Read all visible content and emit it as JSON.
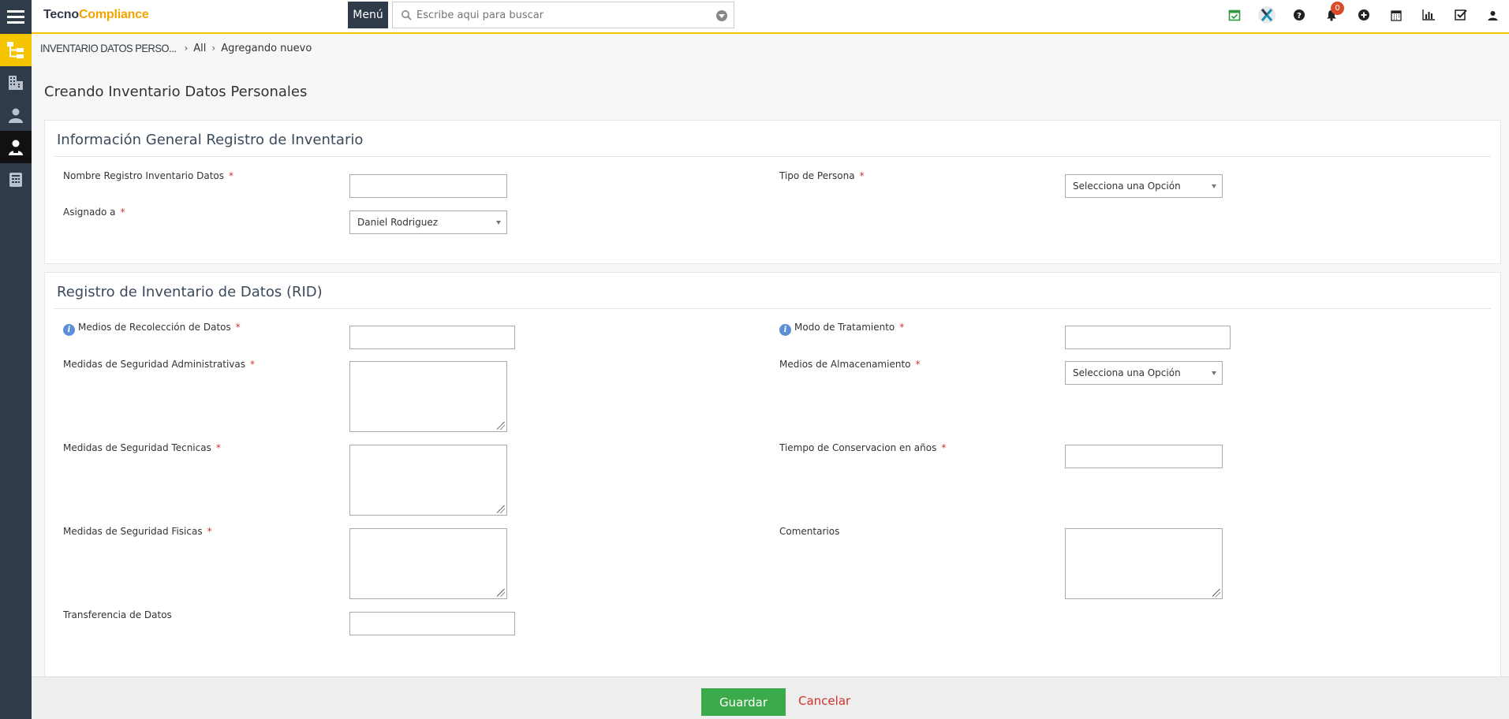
{
  "app": {
    "logo_part1": "Tecno",
    "logo_part2": "Compliance"
  },
  "topbar": {
    "menu_label": "Menú",
    "search_placeholder": "Escribe aqui para buscar",
    "notification_count": "0",
    "icons": [
      "calendar-check-icon",
      "x-logo-icon",
      "help-icon",
      "bell-icon",
      "plus-circle-icon",
      "calendar-icon",
      "bar-chart-icon",
      "checkbox-icon",
      "user-icon"
    ]
  },
  "sidebar": {
    "items": [
      "org-chart-icon",
      "building-icon",
      "person-icon",
      "person-badge-icon",
      "document-icon"
    ],
    "active_index": 3
  },
  "breadcrumb": {
    "title": "INVENTARIO DATOS PERSO...",
    "item1": "All",
    "item2": "Agregando nuevo"
  },
  "page": {
    "title": "Creando Inventario Datos Personales"
  },
  "section1": {
    "title": "Información General Registro de Inventario",
    "nombre_label": "Nombre Registro Inventario Datos",
    "nombre_value": "",
    "tipo_label": "Tipo de Persona",
    "tipo_value": "Selecciona una Opción",
    "asignado_label": "Asignado a",
    "asignado_value": "Daniel Rodriguez"
  },
  "section2": {
    "title": "Registro de Inventario de Datos (RID)",
    "medios_recoleccion_label": "Medios de Recolección de Datos",
    "modo_tratamiento_label": "Modo de Tratamiento",
    "seg_admin_label": "Medidas de Seguridad Administrativas",
    "medios_almacenamiento_label": "Medios de Almacenamiento",
    "medios_almacenamiento_value": "Selecciona una Opción",
    "seg_tecnicas_label": "Medidas de Seguridad Tecnicas",
    "tiempo_label": "Tiempo de Conservacion en años",
    "seg_fisicas_label": "Medidas de Seguridad Fisicas",
    "comentarios_label": "Comentarios",
    "transferencia_label": "Transferencia de Datos",
    "required_mark": "*"
  },
  "footer": {
    "save_label": "Guardar",
    "cancel_label": "Cancelar"
  },
  "colors": {
    "brand_dark": "#2f3b48",
    "brand_yellow": "#f5c400",
    "save_green": "#3aaa4a",
    "required_red": "#d0312d"
  }
}
